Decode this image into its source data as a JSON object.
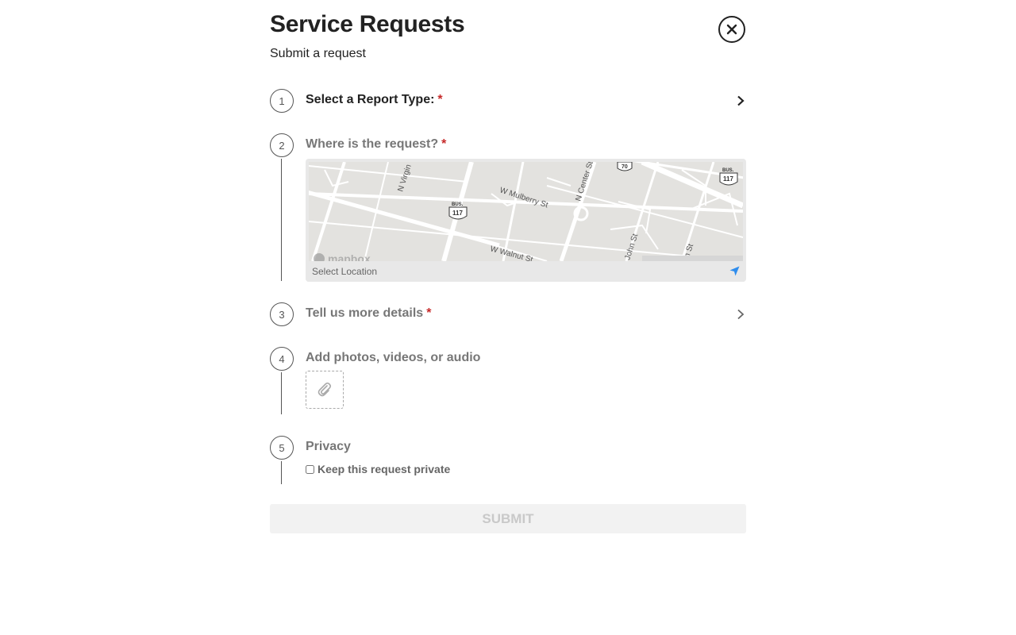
{
  "header": {
    "title": "Service Requests",
    "subtitle": "Submit a request"
  },
  "steps": [
    {
      "number": "1",
      "label": "Select a Report Type:",
      "required_mark": "*"
    },
    {
      "number": "2",
      "label": "Where is the request?",
      "required_mark": "*"
    },
    {
      "number": "3",
      "label": "Tell us more details",
      "required_mark": "*"
    },
    {
      "number": "4",
      "label": "Add photos, videos, or audio"
    },
    {
      "number": "5",
      "label": "Privacy"
    }
  ],
  "map": {
    "streets": [
      "N Virgin",
      "W Mulberry St",
      "N Center St",
      "W Walnut St",
      "John St",
      "m St"
    ],
    "shields": [
      "117",
      "117",
      "70"
    ],
    "shield_caption": "BUS.",
    "attribution": "mapbox",
    "footer_text": "Select Location"
  },
  "privacy": {
    "checkbox_label": "Keep this request private",
    "checked": false
  },
  "submit_label": "SUBMIT",
  "colors": {
    "required": "#c62828",
    "locate_icon": "#2f8ded",
    "submit_bg": "#f2f2f2",
    "submit_text": "#c9c9c9"
  }
}
